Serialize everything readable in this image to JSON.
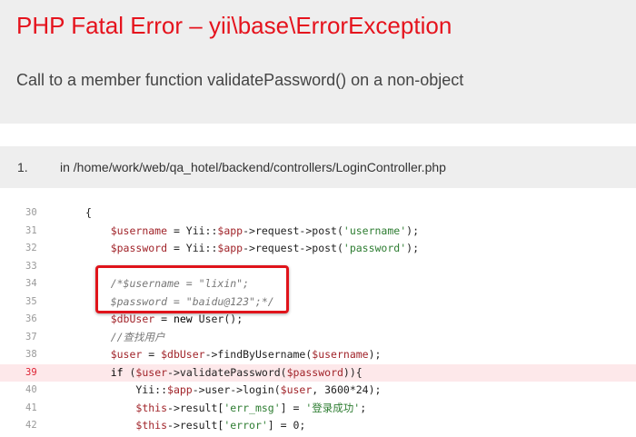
{
  "error": {
    "title_main": "PHP Fatal Error",
    "title_sep": " – ",
    "title_class": "yii\\base\\ErrorException",
    "message": "Call to a member function validatePassword() on a non-object"
  },
  "frame": {
    "number": "1.",
    "file": "in /home/work/web/qa_hotel/backend/controllers/LoginController.php"
  },
  "code_lines": [
    {
      "num": "30",
      "text": "{"
    },
    {
      "num": "31",
      "text": "    $username = Yii::$app->request->post('username');"
    },
    {
      "num": "32",
      "text": "    $password = Yii::$app->request->post('password');"
    },
    {
      "num": "33",
      "text": ""
    },
    {
      "num": "34",
      "text": "    /*$username = \"lixin\";"
    },
    {
      "num": "35",
      "text": "    $password = \"baidu@123\";*/"
    },
    {
      "num": "36",
      "text": "    $dbUser = new User();"
    },
    {
      "num": "37",
      "text": "    //查找用户"
    },
    {
      "num": "38",
      "text": "    $user = $dbUser->findByUsername($username);"
    },
    {
      "num": "39",
      "text": "    if ($user->validatePassword($password)){"
    },
    {
      "num": "40",
      "text": "        Yii::$app->user->login($user, 3600*24);"
    },
    {
      "num": "41",
      "text": "        $this->result['err_msg'] = '登录成功';"
    },
    {
      "num": "42",
      "text": "        $this->result['error'] = 0;"
    }
  ],
  "highlighted_line": "39",
  "colors": {
    "error_red": "#e5131d",
    "highlight_bg": "#fde8ea",
    "annotation_border": "#e0141b"
  }
}
